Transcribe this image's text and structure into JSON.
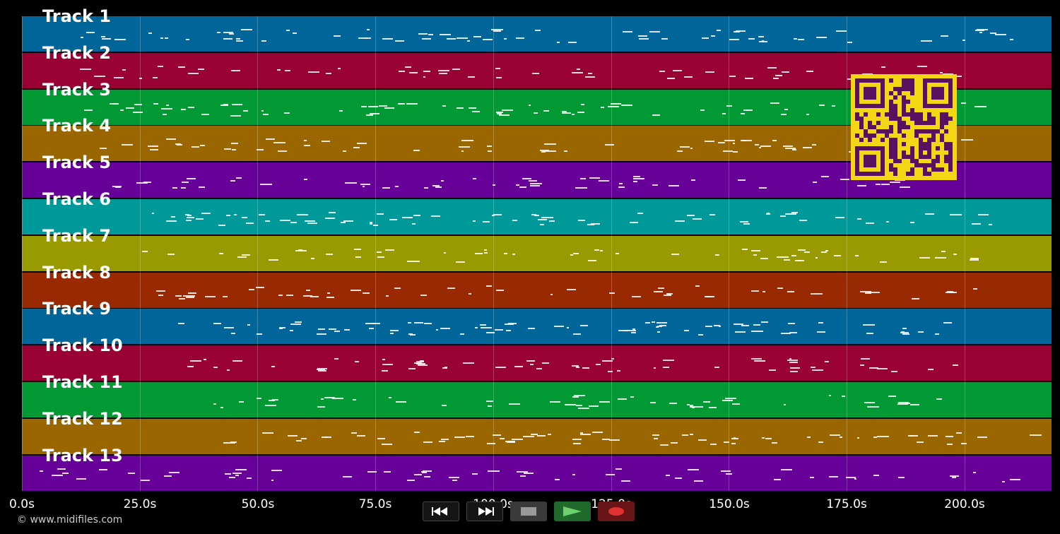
{
  "tracks": [
    {
      "label": "Track 1",
      "color": "#006699"
    },
    {
      "label": "Track 2",
      "color": "#990033"
    },
    {
      "label": "Track 3",
      "color": "#009933"
    },
    {
      "label": "Track 4",
      "color": "#996600"
    },
    {
      "label": "Track 5",
      "color": "#660099"
    },
    {
      "label": "Track 6",
      "color": "#009999"
    },
    {
      "label": "Track 7",
      "color": "#999900"
    },
    {
      "label": "Track 8",
      "color": "#992900"
    },
    {
      "label": "Track 9",
      "color": "#006699"
    },
    {
      "label": "Track 10",
      "color": "#990033"
    },
    {
      "label": "Track 11",
      "color": "#009933"
    },
    {
      "label": "Track 12",
      "color": "#996600"
    },
    {
      "label": "Track 13",
      "color": "#660099"
    }
  ],
  "timeline": {
    "duration_seconds": 218.5,
    "tick_labels": [
      "0.0s",
      "25.0s",
      "50.0s",
      "75.0s",
      "100.0s",
      "125.0s",
      "150.0s",
      "175.0s",
      "200.0s"
    ]
  },
  "transport": {
    "rewind_icon": "rewind-icon",
    "fast_forward_icon": "fast-forward-icon",
    "stop_icon": "stop-icon",
    "play_icon": "play-icon",
    "record_icon": "record-icon"
  },
  "footer": {
    "copyright": "© www.midifiles.com"
  },
  "qr_code": {
    "color": "#f5d614",
    "dark_color": "#5a1060"
  }
}
